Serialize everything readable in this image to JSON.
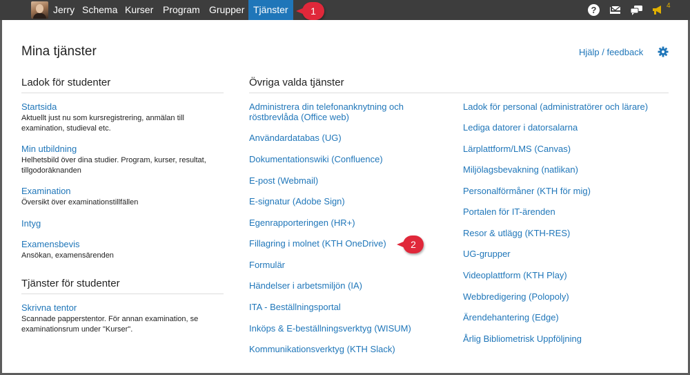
{
  "nav": {
    "user": "Jerry",
    "items": [
      "Schema",
      "Kurser",
      "Program",
      "Grupper",
      "Tjänster"
    ],
    "help_icon_glyph": "?",
    "notification_count": "4"
  },
  "callouts": [
    "1",
    "2"
  ],
  "page": {
    "title": "Mina tjänster",
    "help_link": "Hjälp / feedback"
  },
  "ladok": {
    "title": "Ladok för studenter",
    "items": [
      {
        "label": "Startsida",
        "desc_lines": [
          "Aktuellt just nu som kursregistrering, anmälan till",
          "examination, studieval etc."
        ]
      },
      {
        "label": "Min utbildning",
        "desc_lines": [
          "Helhetsbild över dina studier. Program, kurser, resultat,",
          "tillgodoräknanden"
        ]
      },
      {
        "label": "Examination",
        "desc_lines": [
          "Översikt över examinationstillfällen"
        ]
      },
      {
        "label": "Intyg",
        "desc_lines": []
      },
      {
        "label": "Examensbevis",
        "desc_lines": [
          "Ansökan, examensärenden"
        ]
      }
    ]
  },
  "student_services": {
    "title": "Tjänster för studenter",
    "items": [
      {
        "label": "Skrivna tentor",
        "desc_lines": [
          "Scannade papperstentor. För annan examination, se",
          "examinationsrum under \"Kurser\"."
        ]
      }
    ]
  },
  "other": {
    "title": "Övriga valda tjänster",
    "col1": [
      [
        "Administrera din telefonanknytning och",
        "röstbrevlåda (Office web)"
      ],
      [
        "Användardatabas (UG)"
      ],
      [
        "Dokumentationswiki (Confluence)"
      ],
      [
        "E-post (Webmail)"
      ],
      [
        "E-signatur (Adobe Sign)"
      ],
      [
        "Egenrapporteringen (HR+)"
      ],
      [
        "Fillagring i molnet (KTH OneDrive)"
      ],
      [
        "Formulär"
      ],
      [
        "Händelser i arbetsmiljön (IA)"
      ],
      [
        "ITA - Beställningsportal"
      ],
      [
        "Inköps & E-beställningsverktyg (WISUM)"
      ],
      [
        "Kommunikationsverktyg (KTH Slack)"
      ]
    ],
    "col2": [
      "Ladok för personal (administratörer och lärare)",
      "Lediga datorer i datorsalarna",
      "Lärplattform/LMS (Canvas)",
      "Miljölagsbevakning (natlikan)",
      "Personalförmåner (KTH för mig)",
      "Portalen för IT-ärenden",
      "Resor & utlägg (KTH-RES)",
      "UG-grupper",
      "Videoplattform (KTH Play)",
      "Webbredigering (Polopoly)",
      "Ärendehantering (Edge)",
      "Årlig Bibliometrisk Uppföljning"
    ]
  }
}
